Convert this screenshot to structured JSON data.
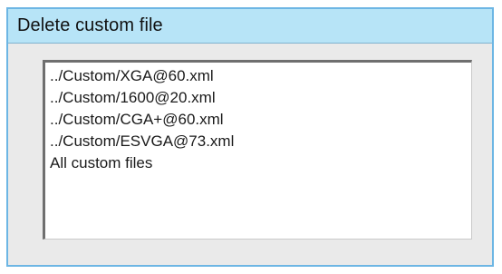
{
  "dialog": {
    "title": "Delete custom file"
  },
  "list": {
    "items": [
      {
        "label": "../Custom/XGA@60.xml"
      },
      {
        "label": "../Custom/1600@20.xml"
      },
      {
        "label": "../Custom/CGA+@60.xml"
      },
      {
        "label": "../Custom/ESVGA@73.xml"
      },
      {
        "label": "All custom files"
      }
    ]
  },
  "colors": {
    "title_bar": "#b7e4f7",
    "border_accent": "#6db6e4",
    "panel_background": "#eaeaea"
  }
}
